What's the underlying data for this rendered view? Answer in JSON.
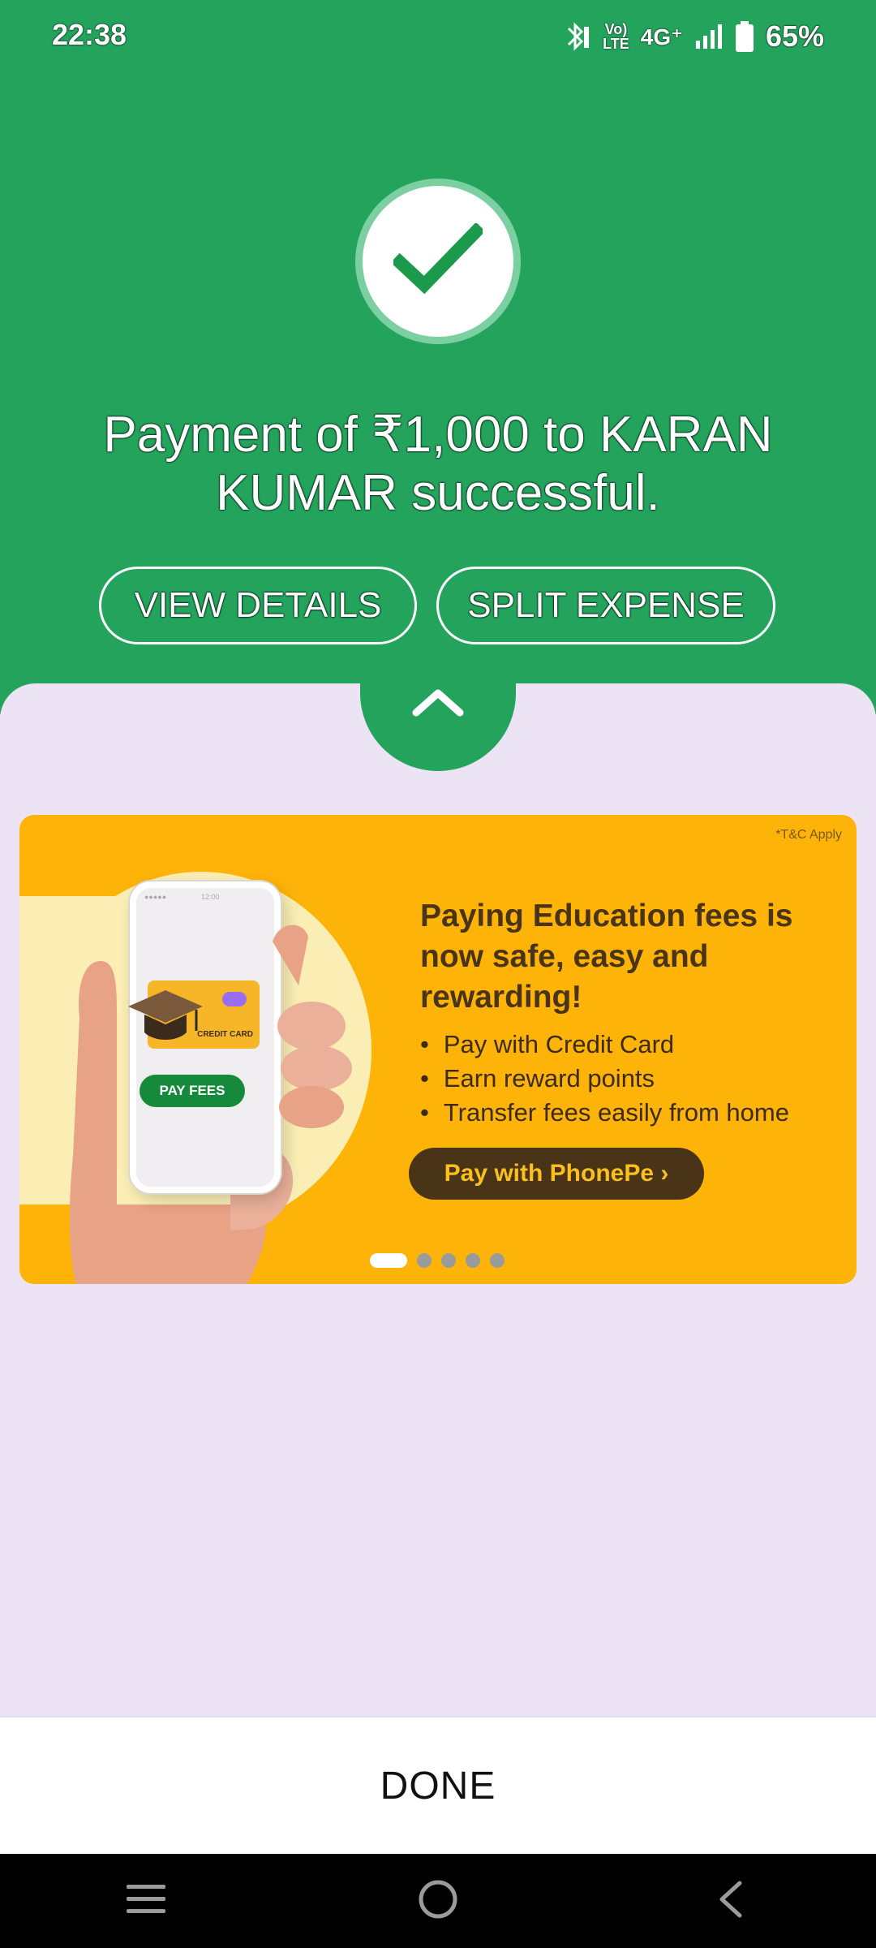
{
  "status_bar": {
    "time": "22:38",
    "volte_top": "Vo)",
    "volte_bottom": "LTE",
    "network": "4G⁺",
    "battery": "65%",
    "icons": [
      "bluetooth-icon",
      "volte-icon",
      "signal-icon",
      "battery-icon"
    ]
  },
  "success": {
    "icon": "checkmark-icon",
    "message": "Payment of ₹1,000 to KARAN KUMAR successful.",
    "view_details_label": "VIEW DETAILS",
    "split_expense_label": "SPLIT EXPENSE",
    "expand_icon": "chevron-up-icon"
  },
  "banner": {
    "tnc": "*T&C Apply",
    "title": "Paying Education fees is now safe, easy and rewarding!",
    "bullets": [
      "Pay with Credit Card",
      "Earn reward points",
      "Transfer fees easily from home"
    ],
    "cta": "Pay with PhonePe ›",
    "phone_card_label": "CREDIT CARD",
    "phone_button_label": "PAY FEES",
    "phone_time": "12:00",
    "slides_total": 5,
    "active_slide": 1
  },
  "footer": {
    "done_label": "DONE"
  },
  "nav": {
    "icons": [
      "menu-icon",
      "home-icon",
      "back-icon"
    ]
  },
  "colors": {
    "green": "#23a35c",
    "lavender": "#ece4f5",
    "banner_yellow": "#fdb308",
    "banner_brown": "#4a3418"
  }
}
